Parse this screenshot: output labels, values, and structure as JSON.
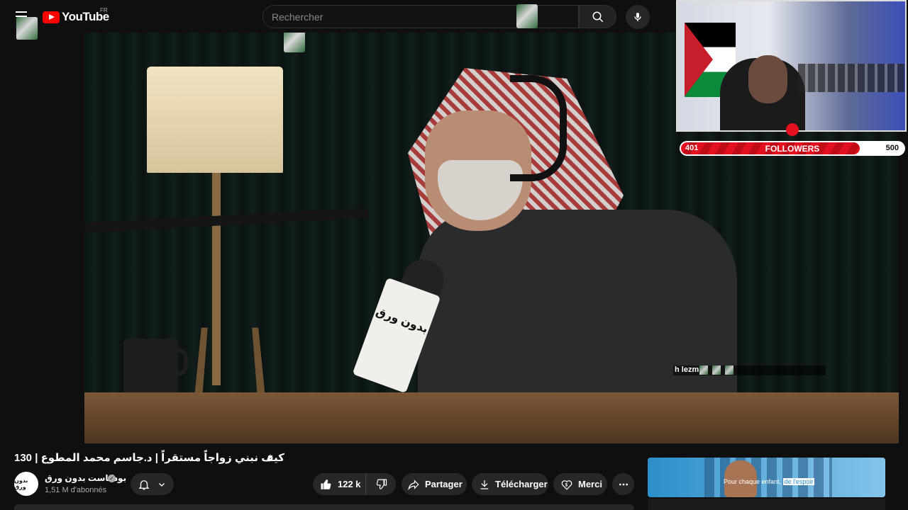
{
  "header": {
    "logo_text": "YouTube",
    "country_code": "FR",
    "search_placeholder": "Rechercher"
  },
  "overlay": {
    "chat_text": "h lezm",
    "followers": {
      "current": "401",
      "label": "FOLLOWERS",
      "goal": "500",
      "progress_fraction": 0.802
    }
  },
  "video": {
    "title": "كيف نبني زواجاً مستقراً | د.جاسم محمد المطوع | 130",
    "mic_label": "بدون ورق"
  },
  "channel": {
    "avatar_text": "بدون ورق",
    "name": "بودكاست بدون ورق",
    "verified_mark": "✓",
    "subscribers": "1,51 M d'abonnés"
  },
  "actions": {
    "likes": "122 k",
    "share": "Partager",
    "download": "Télécharger",
    "thanks": "Merci"
  },
  "ad": {
    "text_part1": "Pour chaque enfant,",
    "text_part2": "de l'espoir"
  },
  "colors": {
    "brand_red": "#ff0000",
    "follower_red": "#e3101f",
    "background": "#0f0f0f"
  }
}
